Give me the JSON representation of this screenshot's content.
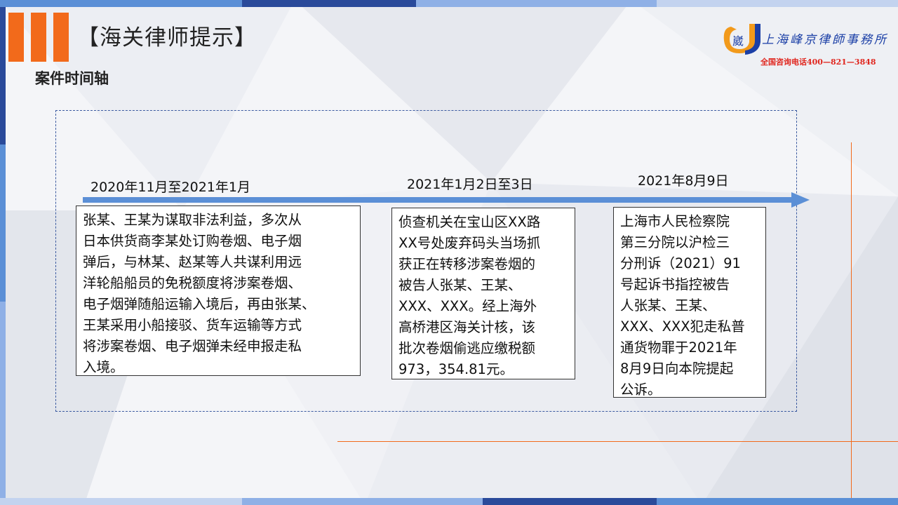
{
  "header": {
    "title": "【海关律师提示】",
    "subtitle": "案件时间轴"
  },
  "firm": {
    "logo_char": "崴",
    "name": "上海峰京律師事務所",
    "hotline": "全国咨询电话400—821—3848"
  },
  "timeline": {
    "events": [
      {
        "date": "2020年11月至2021年1月",
        "lines": [
          "张某、王某为谋取非法利益，多次从",
          "日本供货商李某处订购卷烟、电子烟",
          "弹后，与林某、赵某等人共谋利用远",
          "洋轮船船员的免税额度将涉案卷烟、",
          "电子烟弹随船运输入境后，再由张某、",
          "王某采用小船接驳、货车运输等方式",
          "将涉案卷烟、电子烟弹未经申报走私",
          "入境。"
        ]
      },
      {
        "date": "2021年1月2日至3日",
        "lines": [
          "侦查机关在宝山区XX路",
          "XX号处废弃码头当场抓",
          "获正在转移涉案卷烟的",
          "被告人张某、王某、",
          "XXX、XXX。经上海外",
          "高桥港区海关计核，该",
          "批次卷烟偷逃应缴税额",
          "973，354.81元。"
        ]
      },
      {
        "date": "2021年8月9日",
        "lines": [
          "上海市人民检察院",
          "第三分院以沪检三",
          "分刑诉（2021）91",
          "号起诉书指控被告",
          "人张某、王某、",
          "XXX、XXX犯走私普",
          "通货物罪于2021年",
          "8月9日向本院提起",
          "公诉。"
        ]
      }
    ]
  },
  "colors": {
    "accent": "#f26a1b",
    "arrow": "#5b8fd6",
    "brand_blue": "#1b3fa6",
    "hotline_red": "#e0261e"
  }
}
